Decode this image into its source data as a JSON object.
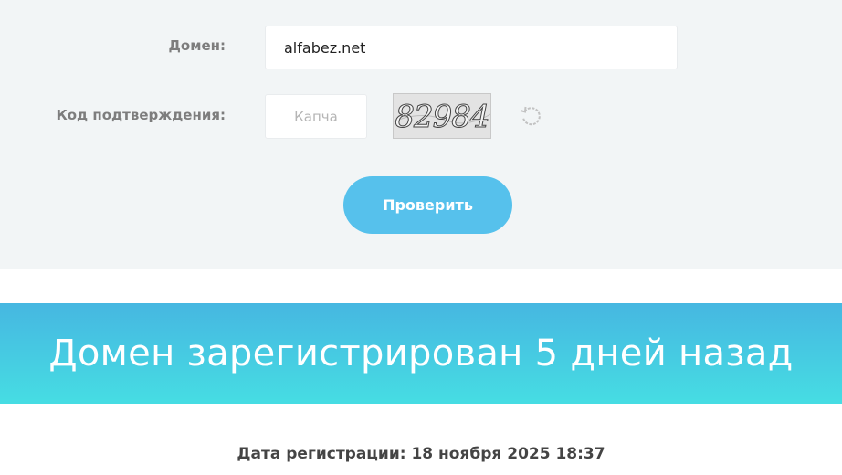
{
  "form": {
    "domain_label": "Домен:",
    "domain_value": "alfabez.net",
    "code_label": "Код подтверждения:",
    "captcha_placeholder": "Капча",
    "captcha_text": "82984",
    "refresh_icon": "refresh-icon",
    "check_button": "Проверить"
  },
  "result": {
    "banner_title": "Домен зарегистрирован 5 дней назад",
    "registration_date": "Дата регистрации: 18 ноября 2025 18:37"
  },
  "colors": {
    "panel_bg": "#f2f5f6",
    "button": "#56c1ec",
    "banner_top": "#46b7e1",
    "banner_bottom": "#46dde3"
  }
}
